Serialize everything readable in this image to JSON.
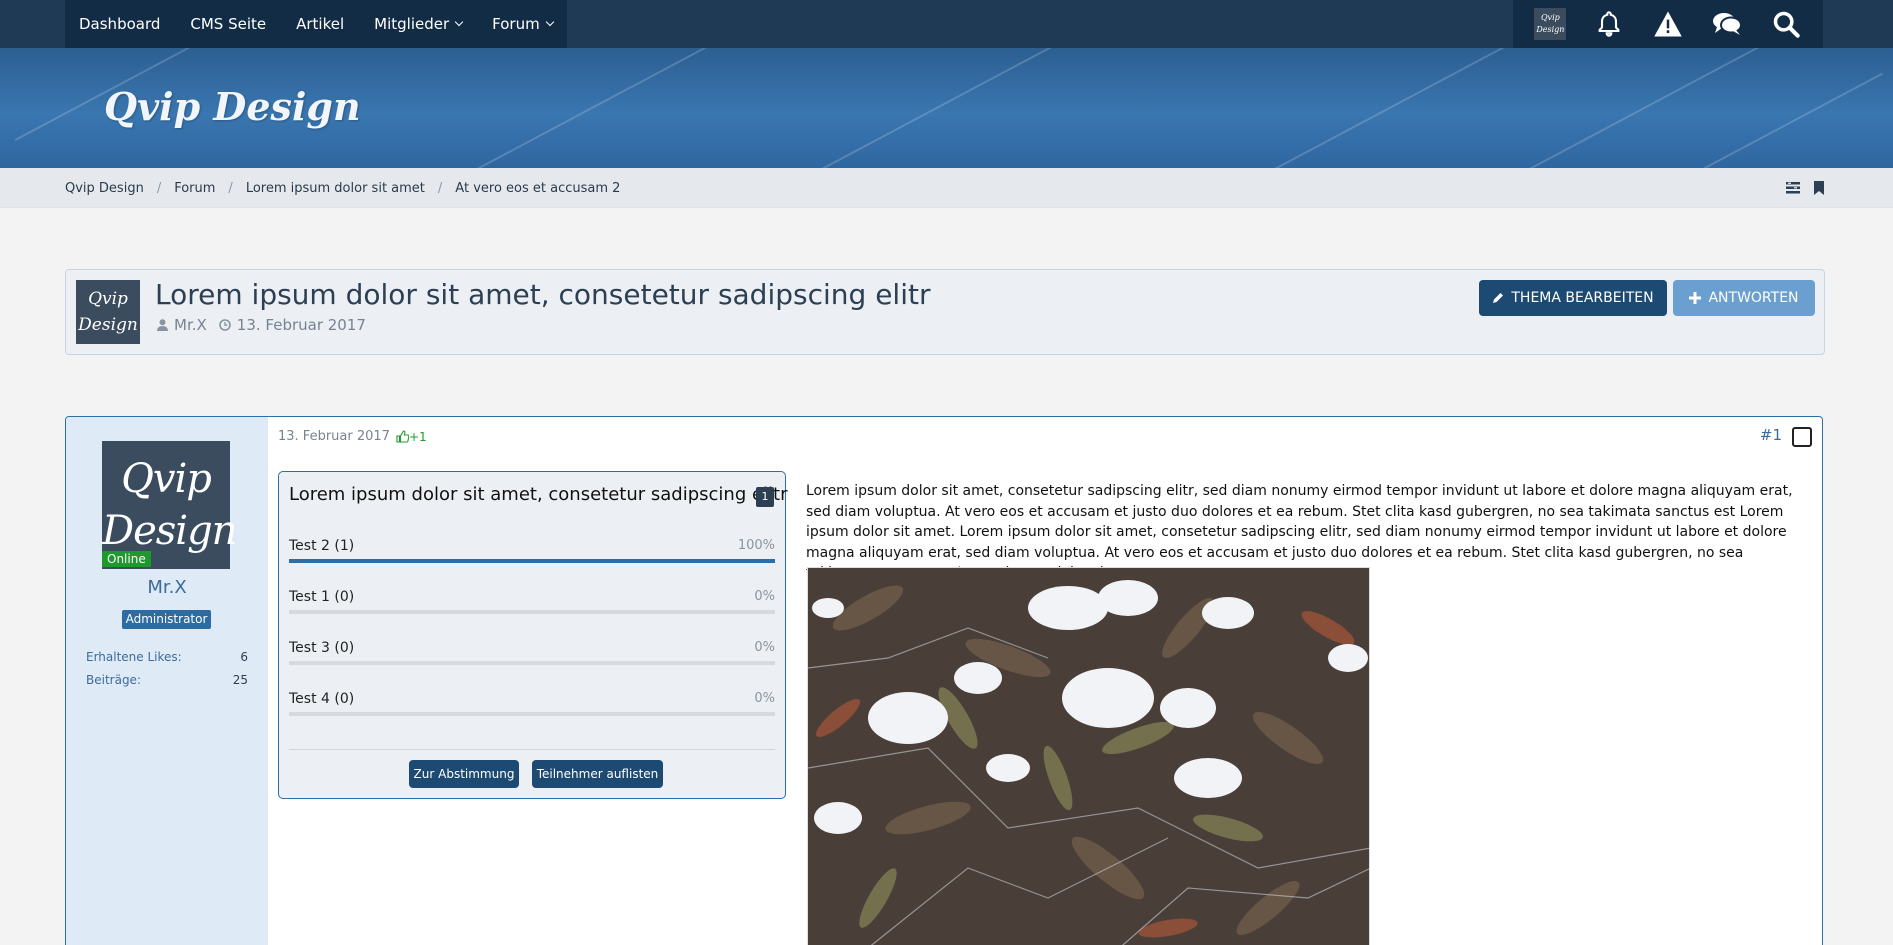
{
  "nav": {
    "items": [
      {
        "label": "Dashboard",
        "dropdown": false
      },
      {
        "label": "CMS Seite",
        "dropdown": false
      },
      {
        "label": "Artikel",
        "dropdown": false
      },
      {
        "label": "Mitglieder",
        "dropdown": true
      },
      {
        "label": "Forum",
        "dropdown": true
      }
    ],
    "icons": [
      "user-avatar-icon",
      "bell-icon",
      "warning-icon",
      "chat-bubbles-icon",
      "search-icon"
    ]
  },
  "header": {
    "brand": "Qvip Design",
    "logo_text": "Qvip Design"
  },
  "breadcrumb": [
    "Qvip Design",
    "Forum",
    "Lorem ipsum dolor sit amet",
    "At vero eos et accusam 2"
  ],
  "thread": {
    "title": "Lorem ipsum dolor sit amet, consetetur sadipscing elitr",
    "author": "Mr.X",
    "date": "13. Februar 2017",
    "edit_label": "THEMA BEARBEITEN",
    "reply_label": "ANTWORTEN"
  },
  "user": {
    "name": "Mr.X",
    "status": "Online",
    "role": "Administrator",
    "stats": [
      {
        "label": "Erhaltene Likes:",
        "value": "6"
      },
      {
        "label": "Beiträge:",
        "value": "25"
      }
    ]
  },
  "post": {
    "date": "13. Februar 2017",
    "likes": "+1",
    "number": "#1",
    "text": "Lorem ipsum dolor sit amet, consetetur sadipscing elitr, sed diam nonumy eirmod tempor invidunt ut labore et dolore magna aliquyam erat, sed diam voluptua. At vero eos et accusam et justo duo dolores et ea rebum. Stet clita kasd gubergren, no sea takimata sanctus est Lorem ipsum dolor sit amet. Lorem ipsum dolor sit amet, consetetur sadipscing elitr, sed diam nonumy eirmod tempor invidunt ut labore et dolore magna aliquyam erat, sed diam voluptua. At vero eos et accusam et justo duo dolores et ea rebum. Stet clita kasd gubergren, no sea takimata sanctus est Lorem ipsum dolor sit amet."
  },
  "poll": {
    "title": "Lorem ipsum dolor sit amet, consetetur sadipscing elitr",
    "count": "1",
    "options": [
      {
        "label": "Test 2 (1)",
        "percent_text": "100%",
        "fraction": 1.0
      },
      {
        "label": "Test 1 (0)",
        "percent_text": "0%",
        "fraction": 0
      },
      {
        "label": "Test 3 (0)",
        "percent_text": "0%",
        "fraction": 0
      },
      {
        "label": "Test 4 (0)",
        "percent_text": "0%",
        "fraction": 0
      }
    ],
    "vote_button": "Zur Abstimmung",
    "participants_button": "Teilnehmer auflisten"
  },
  "colors": {
    "primary": "#1c4a72",
    "accent": "#2a6fa8",
    "online": "#1e9a2c"
  }
}
